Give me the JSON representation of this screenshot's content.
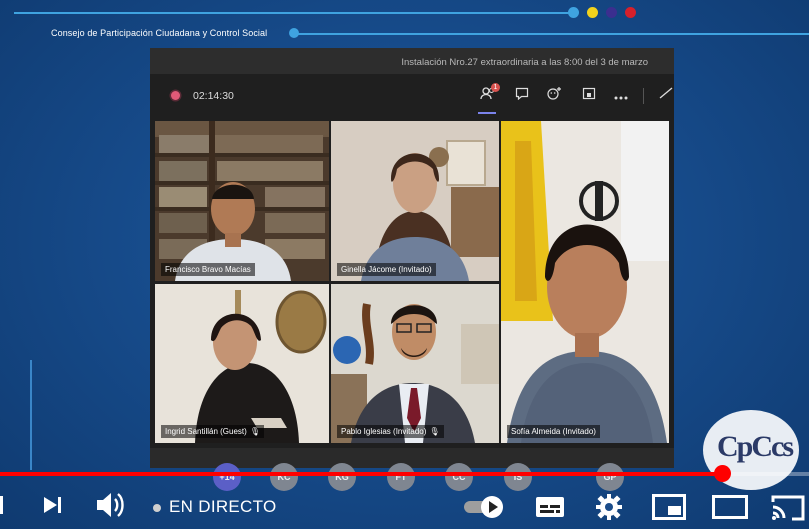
{
  "header": {
    "council_name": "Consejo de Participación Ciudadana y Control Social",
    "dots": [
      "#3fa3e0",
      "#f2d21c",
      "#3b2f8f",
      "#d6202b"
    ]
  },
  "meeting": {
    "title": "Instalación Nro.27 extraordinaria a las 8:00 del 3 de marzo",
    "timer": "02:14:30",
    "participants_badge": "1",
    "participants": [
      {
        "name": "Francisco Bravo Macías",
        "mic_icon": false
      },
      {
        "name": "Ginella Jácome (Invitado)",
        "mic_icon": false
      },
      {
        "name": "Sofía Almeida (Invitado)",
        "mic_icon": false
      },
      {
        "name": "Ingrid Santillán (Guest)",
        "mic_icon": true
      },
      {
        "name": "Pablo Iglesias (Invitado)",
        "mic_icon": true
      }
    ],
    "overflow_avatars": [
      "+14",
      "KC",
      "KG",
      "FT",
      "CC",
      "IS",
      "GP"
    ]
  },
  "player": {
    "progress": 0.893,
    "live_label": "EN DIRECTO",
    "accent": "#ff0000",
    "icons": [
      "next-icon",
      "volume-icon",
      "play-toggle-icon",
      "subtitles-icon",
      "settings-icon",
      "miniplayer-icon",
      "theater-icon",
      "cast-icon"
    ]
  },
  "logo": {
    "text": "CpCcs"
  }
}
